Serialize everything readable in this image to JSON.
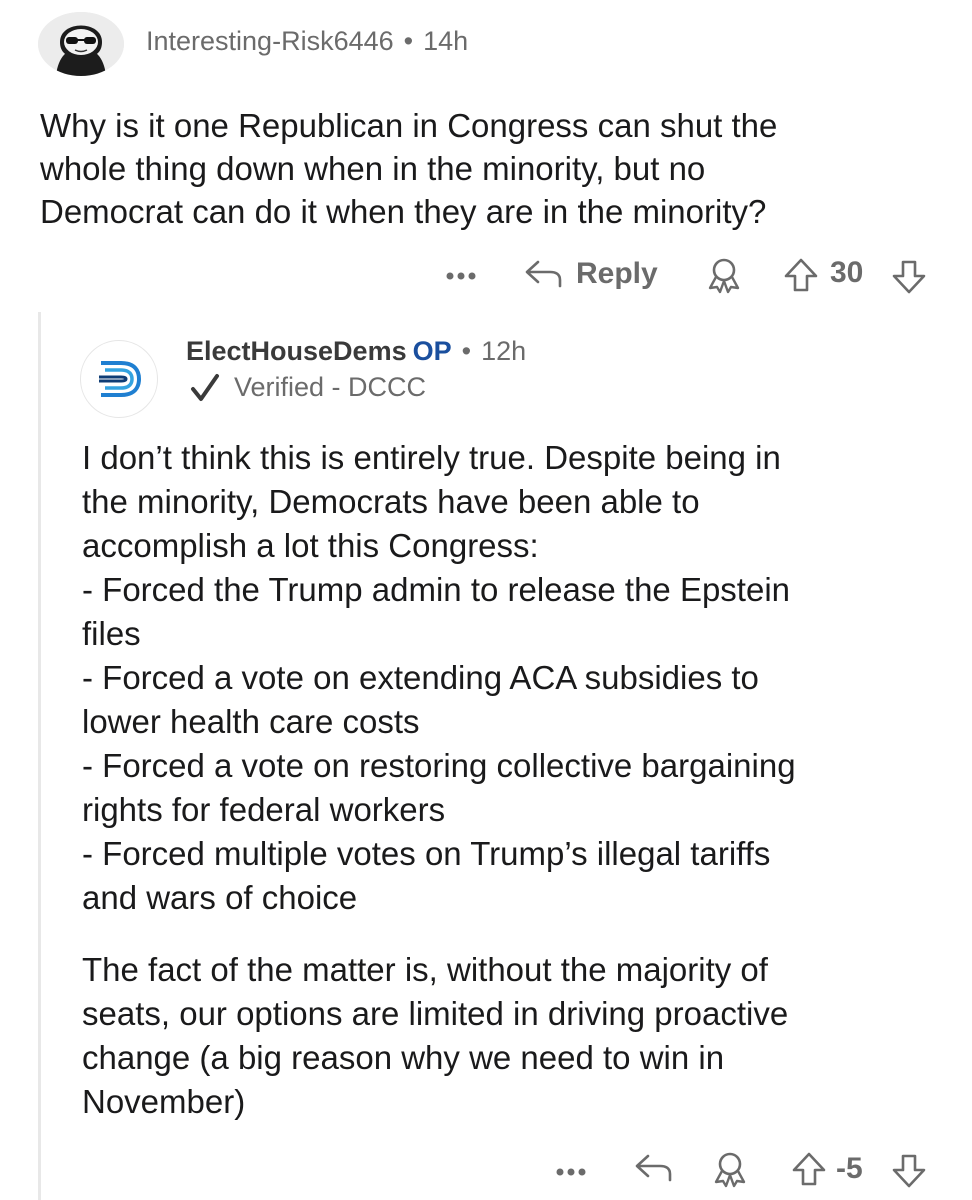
{
  "comment": {
    "author": "Interesting-Risk6446",
    "separator": "•",
    "time": "14h",
    "lines": [
      "Why is it one Republican in Congress can shut the",
      "whole thing down when in the minority, but no",
      "Democrat can do it when they are in the minority?"
    ],
    "actions": {
      "more_icon": "more-options-icon",
      "reply_label": "Reply",
      "award_icon": "award-icon",
      "upvote_icon": "upvote-icon",
      "score": "30",
      "downvote_icon": "downvote-icon"
    }
  },
  "reply": {
    "author": "ElectHouseDems",
    "op_badge": "OP",
    "separator": "•",
    "time": "12h",
    "verified_label": "Verified - DCCC",
    "lines": [
      "I don’t think this is entirely true. Despite being in",
      "the minority, Democrats have been able to",
      "accomplish a lot this Congress:",
      "- Forced the Trump admin to release the Epstein",
      "files",
      "- Forced a vote on extending ACA subsidies to",
      "lower health care costs",
      "- Forced a vote on restoring collective bargaining",
      "rights for federal workers",
      "- Forced multiple votes on Trump’s illegal tariffs",
      "and wars of choice"
    ],
    "lines2": [
      "The fact of the matter is, without the majority of",
      "seats, our options are limited in driving proactive",
      "change (a big reason why we need to win in",
      "November)"
    ],
    "actions": {
      "score": "-5"
    }
  },
  "colors": {
    "text": "#1a1a1b",
    "meta": "#6b6b6b",
    "op": "#1a4f9e",
    "logo_blue": "#1f7fd1"
  }
}
